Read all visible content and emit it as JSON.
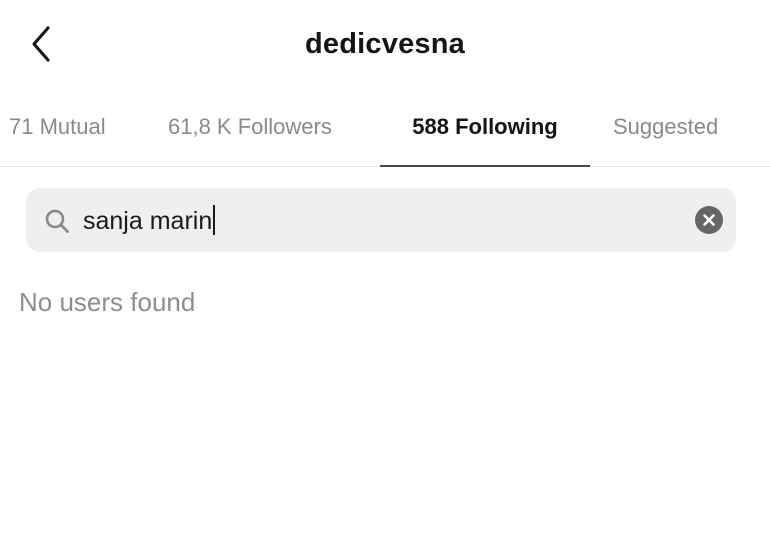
{
  "header": {
    "title": "dedicvesna",
    "back_icon": "chevron-left-icon"
  },
  "tabs": [
    {
      "label": "71 Mutual",
      "active": false
    },
    {
      "label": "61,8 K Followers",
      "active": false
    },
    {
      "label": "588 Following",
      "active": true
    },
    {
      "label": "Suggested",
      "active": false
    }
  ],
  "search": {
    "value": "sanja marin",
    "icon": "search-icon",
    "clear_icon": "clear-icon"
  },
  "results": {
    "empty_message": "No users found"
  },
  "colors": {
    "text_primary": "#151515",
    "text_secondary": "#8a8a8a",
    "search_bg": "#efefef",
    "tab_indicator": "#4a4a4a"
  }
}
